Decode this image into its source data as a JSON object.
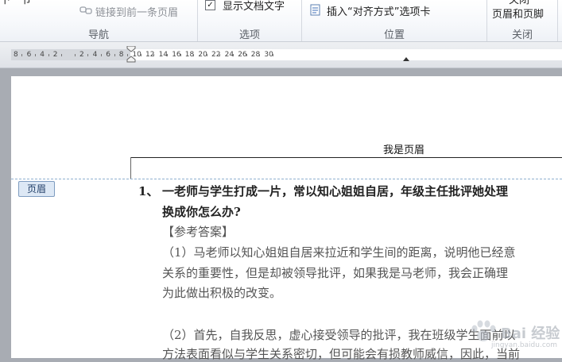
{
  "ribbon": {
    "top_partial_label": "下一节",
    "link_previous_label": "链接到前一条页眉",
    "show_doc_text_label": "显示文档文字",
    "show_doc_text_checked": true,
    "insert_align_tab_label": "插入“对齐方式”选项卡",
    "close_header_footer_label": "页眉和页脚",
    "close_top_partial": "关闭",
    "groups": {
      "navigation": "导航",
      "options": "选项",
      "position": "位置",
      "close": "关闭"
    }
  },
  "ruler": {
    "labels": [
      "8",
      "6",
      "4",
      "2",
      "",
      "2",
      "4",
      "6",
      "8",
      "10",
      "12",
      "14",
      "16",
      "18",
      "20",
      "22",
      "24",
      "26",
      "28",
      "30"
    ]
  },
  "document": {
    "header_text": "我是页眉",
    "header_tag": "页眉",
    "question_number": "1、",
    "question_line1": "一老师与学生打成一片，常以知心姐姐自居，年级主任批评她处理",
    "question_line2": "换成你怎么办?",
    "answer_heading": "【参考答案】",
    "answer_p1_line1": "（1）马老师以知心姐姐自居来拉近和学生间的距离，说明他已经意",
    "answer_p1_line2": "关系的重要性，但是却被领导批评，如果我是马老师，我会正确理",
    "answer_p1_line3": "为此做出积极的改变。",
    "answer_p2_line1": "（2）首先，自我反思，虚心接受领导的批评，我在班级学生面前以",
    "answer_p2_line2": "方法表面看似与学生关系密切，但可能会有损教师威信，因此，当前"
  },
  "watermark": {
    "text": "Bai 经验",
    "subtext": "jingyan.baidu.com"
  }
}
